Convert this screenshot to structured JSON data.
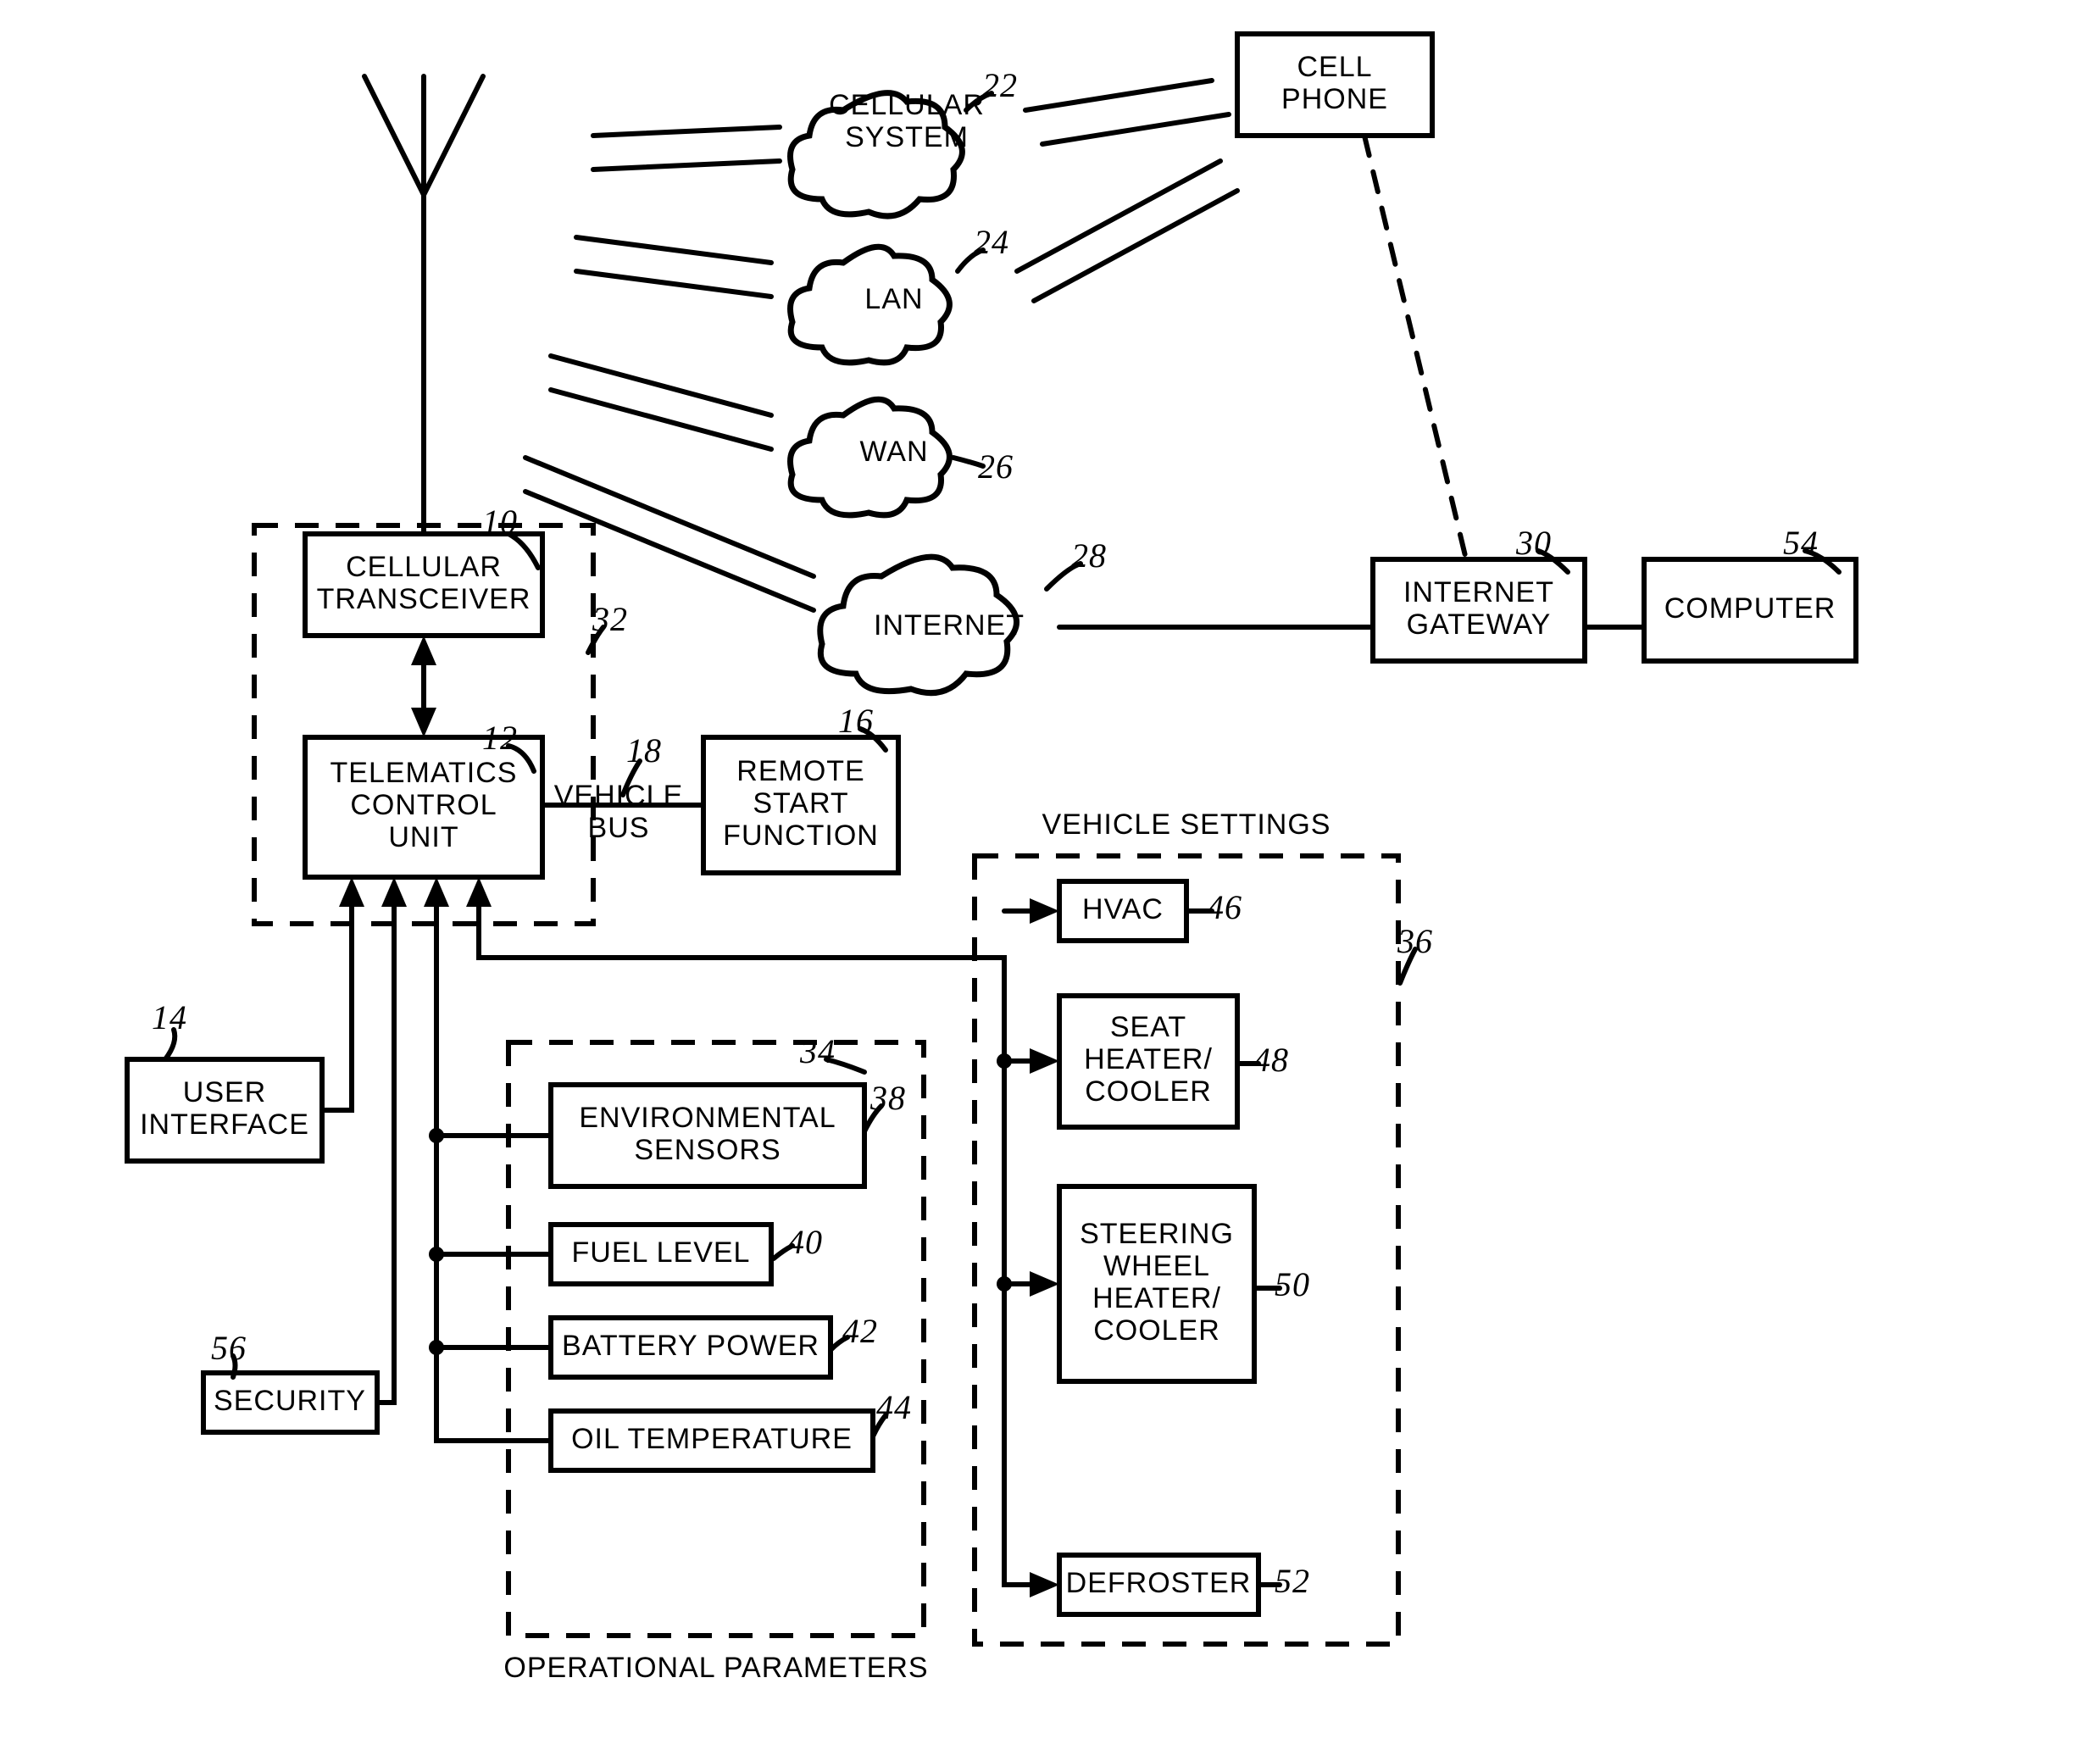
{
  "nodes": {
    "cellular_transceiver": "CELLULAR\nTRANSCEIVER",
    "telematics_control_unit": "TELEMATICS\nCONTROL\nUNIT",
    "vehicle_bus": "VEHICLE\nBUS",
    "remote_start_function": "REMOTE\nSTART\nFUNCTION",
    "user_interface": "USER\nINTERFACE",
    "security": "SECURITY",
    "cellular_system": "CELLULAR\nSYSTEM",
    "lan": "LAN",
    "wan": "WAN",
    "internet": "INTERNET",
    "cell_phone": "CELL\nPHONE",
    "internet_gateway": "INTERNET\nGATEWAY",
    "computer": "COMPUTER",
    "environmental_sensors": "ENVIRONMENTAL\nSENSORS",
    "fuel_level": "FUEL LEVEL",
    "battery_power": "BATTERY POWER",
    "oil_temperature": "OIL TEMPERATURE",
    "hvac": "HVAC",
    "seat_heater_cooler": "SEAT\nHEATER/\nCOOLER",
    "steering_wheel_heater_cooler": "STEERING\nWHEEL\nHEATER/\nCOOLER",
    "defroster": "DEFROSTER"
  },
  "labels": {
    "operational_parameters": "OPERATIONAL PARAMETERS",
    "vehicle_settings": "VEHICLE SETTINGS"
  },
  "refs": {
    "cellular_transceiver": "10",
    "telematics_control_unit": "12",
    "user_interface": "14",
    "remote_start_function": "16",
    "vehicle_bus": "18",
    "cellular_system": "22",
    "lan": "24",
    "wan": "26",
    "internet": "28",
    "internet_gateway": "30",
    "tcu_group": "32",
    "op_params_group": "34",
    "vehicle_settings_group": "36",
    "environmental_sensors": "38",
    "fuel_level": "40",
    "battery_power": "42",
    "oil_temperature": "44",
    "hvac": "46",
    "seat_heater_cooler": "48",
    "steering_wheel_heater_cooler": "50",
    "defroster": "52",
    "computer": "54",
    "security": "56"
  }
}
